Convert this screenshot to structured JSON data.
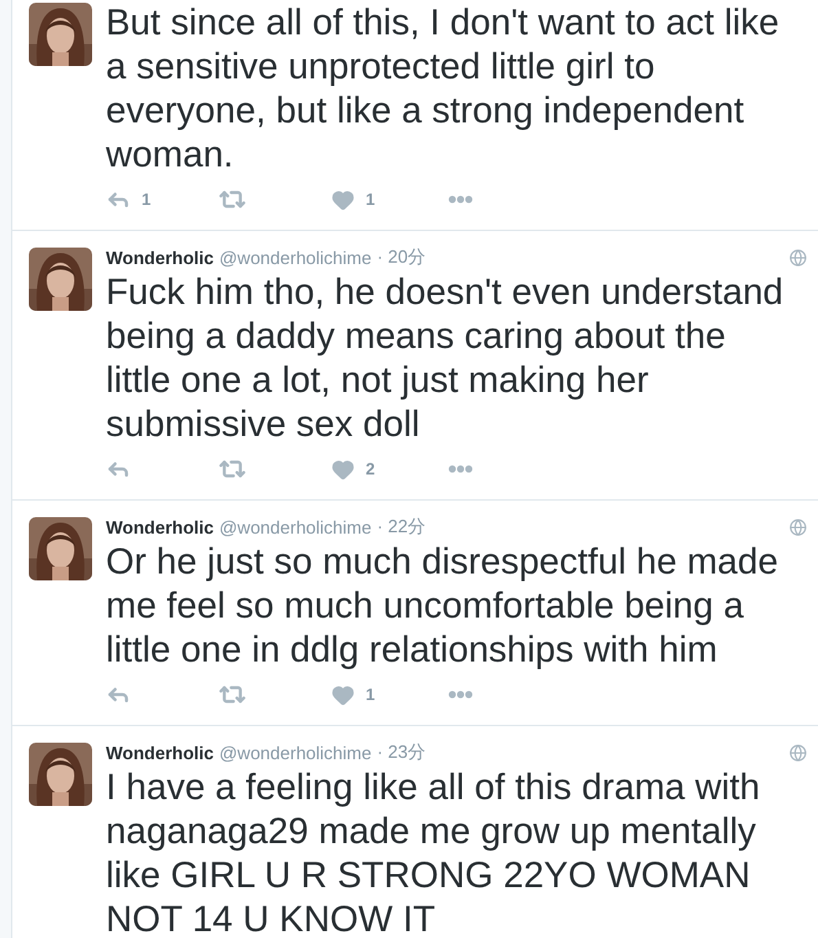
{
  "tweets": [
    {
      "text": "But since all of this, I don't want to act like a sensitive unprotected little girl to everyone,  but like a strong independent woman.",
      "actions": {
        "replies": "1",
        "likes": "1"
      }
    },
    {
      "author": "Wonderholic",
      "handle": "@wonderholichime",
      "time": "· 20分",
      "text": "Fuck him tho, he doesn't even understand being a daddy means caring about the little one a lot, not just making her submissive sex doll",
      "actions": {
        "likes": "2"
      }
    },
    {
      "author": "Wonderholic",
      "handle": "@wonderholichime",
      "time": "· 22分",
      "text": "Or he just so much disrespectful he made me feel so much uncomfortable being a little one in ddlg relationships with him",
      "actions": {
        "likes": "1"
      }
    },
    {
      "author": "Wonderholic",
      "handle": "@wonderholichime",
      "time": "· 23分",
      "text": "I have a feeling like all of this drama with naganaga29 made me grow up mentally like GIRL U R STRONG 22YO WOMAN NOT 14 U KNOW IT"
    }
  ]
}
